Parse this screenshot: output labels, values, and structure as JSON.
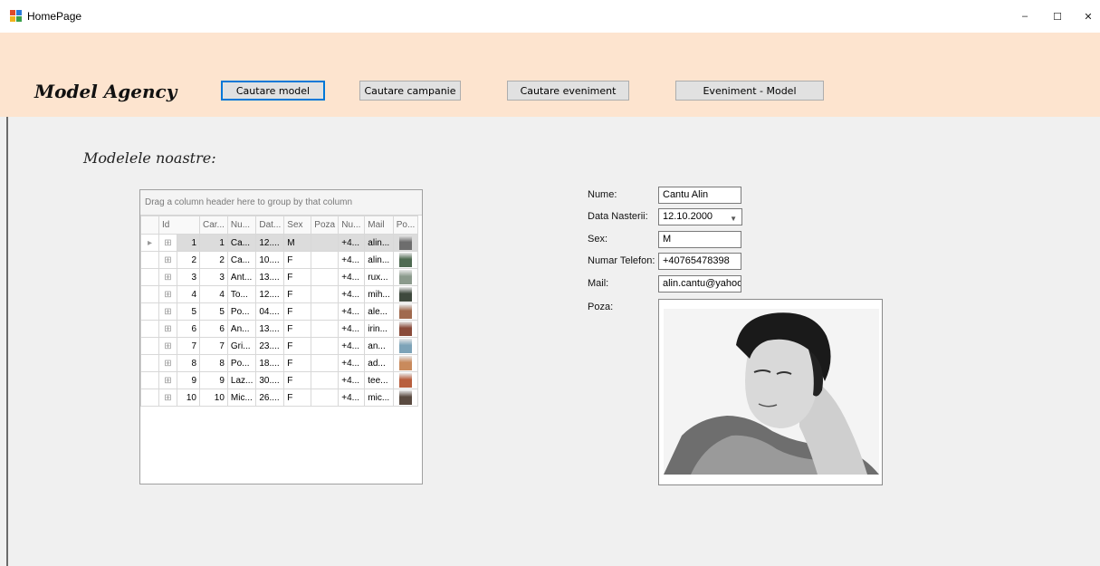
{
  "window": {
    "title": "HomePage",
    "min_glyph": "–",
    "max_glyph": "☐",
    "close_glyph": "✕"
  },
  "header": {
    "brand": "Model Agency",
    "nav": [
      {
        "label": "Cautare model"
      },
      {
        "label": "Cautare campanie"
      },
      {
        "label": "Cautare eveniment"
      },
      {
        "label": "Eveniment - Model"
      }
    ]
  },
  "section_title": "Modelele noastre:",
  "grid": {
    "group_hint": "Drag a column header here to group by that column",
    "columns": [
      "Id",
      "Car...",
      "Nu...",
      "Dat...",
      "Sex",
      "Poza",
      "Nu...",
      "Mail",
      "Po..."
    ],
    "rows": [
      {
        "id": "1",
        "car": "1",
        "nu": "Ca...",
        "dat": "12....",
        "sex": "M",
        "poza": "",
        "tel": "+4...",
        "mail": "alin...",
        "thumb": "#6d6d6d"
      },
      {
        "id": "2",
        "car": "2",
        "nu": "Ca...",
        "dat": "10....",
        "sex": "F",
        "poza": "",
        "tel": "+4...",
        "mail": "alin...",
        "thumb": "#4f6b52"
      },
      {
        "id": "3",
        "car": "3",
        "nu": "Ant...",
        "dat": "13....",
        "sex": "F",
        "poza": "",
        "tel": "+4...",
        "mail": "rux...",
        "thumb": "#8b9a8c"
      },
      {
        "id": "4",
        "car": "4",
        "nu": "To...",
        "dat": "12....",
        "sex": "F",
        "poza": "",
        "tel": "+4...",
        "mail": "mih...",
        "thumb": "#3f4a3e"
      },
      {
        "id": "5",
        "car": "5",
        "nu": "Po...",
        "dat": "04....",
        "sex": "F",
        "poza": "",
        "tel": "+4...",
        "mail": "ale...",
        "thumb": "#a06a4e"
      },
      {
        "id": "6",
        "car": "6",
        "nu": "An...",
        "dat": "13....",
        "sex": "F",
        "poza": "",
        "tel": "+4...",
        "mail": "irin...",
        "thumb": "#8a4b3a"
      },
      {
        "id": "7",
        "car": "7",
        "nu": "Gri...",
        "dat": "23....",
        "sex": "F",
        "poza": "",
        "tel": "+4...",
        "mail": "an...",
        "thumb": "#7da3b8"
      },
      {
        "id": "8",
        "car": "8",
        "nu": "Po...",
        "dat": "18....",
        "sex": "F",
        "poza": "",
        "tel": "+4...",
        "mail": "ad...",
        "thumb": "#c98a5c"
      },
      {
        "id": "9",
        "car": "9",
        "nu": "Laz...",
        "dat": "30....",
        "sex": "F",
        "poza": "",
        "tel": "+4...",
        "mail": "tee...",
        "thumb": "#b85f3e"
      },
      {
        "id": "10",
        "car": "10",
        "nu": "Mic...",
        "dat": "26....",
        "sex": "F",
        "poza": "",
        "tel": "+4...",
        "mail": "mic...",
        "thumb": "#5a4a40"
      }
    ]
  },
  "details": {
    "nume_label": "Nume:",
    "nume_value": "Cantu Alin",
    "data_label": "Data Nasterii:",
    "data_value": "12.10.2000",
    "sex_label": "Sex:",
    "sex_value": "M",
    "tel_label": "Numar Telefon:",
    "tel_value": "+40765478398",
    "mail_label": "Mail:",
    "mail_value": "alin.cantu@yahoo.c",
    "poza_label": "Poza:"
  }
}
